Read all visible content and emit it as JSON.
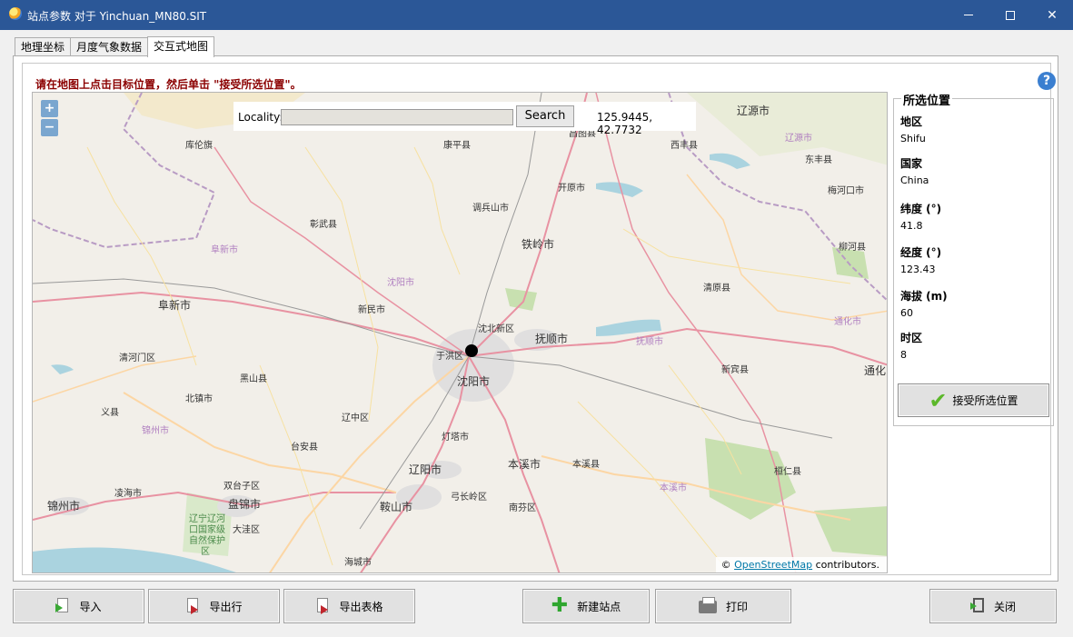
{
  "window": {
    "title": "站点参数 对于 Yinchuan_MN80.SIT",
    "app_icon": "app-globe-icon"
  },
  "tabs": [
    {
      "label": "地理坐标",
      "active": false
    },
    {
      "label": "月度气象数据",
      "active": false
    },
    {
      "label": "交互式地图",
      "active": true
    }
  ],
  "instruction": "请在地图上点击目标位置，然后单击 \"接受所选位置\"。",
  "map": {
    "zoom_in": "+",
    "zoom_out": "−",
    "locality_label": "Locality:",
    "locality_value": "",
    "search_button": "Search",
    "coords": "125.9445, 42.7732",
    "attribution_prefix": "©",
    "attribution_link": "OpenStreetMap",
    "attribution_suffix": "contributors.",
    "places": [
      "辽源市",
      "辽源市",
      "东丰县",
      "梅河口市",
      "柳河县",
      "通化市",
      "通化",
      "康平县",
      "西丰县",
      "昌图县",
      "开原市",
      "调兵山市",
      "铁岭市",
      "彰武县",
      "库伦旗",
      "阜新市",
      "阜新市",
      "沈阳市",
      "新民市",
      "沈北新区",
      "于洪区",
      "抚顺市",
      "抚顺市",
      "沈阳市",
      "清原县",
      "新宾县",
      "清河门区",
      "黑山县",
      "北镇市",
      "锦州市",
      "义县",
      "辽中区",
      "台安县",
      "灯塔市",
      "辽阳市",
      "本溪市",
      "本溪县",
      "桓仁县",
      "双台子区",
      "凌海市",
      "盘锦市",
      "大洼区",
      "鞍山市",
      "弓长岭区",
      "南芬区",
      "本溪市",
      "锦州市",
      "辽宁辽河口国家级自然保护区",
      "海城市"
    ]
  },
  "selected": {
    "legend": "所选位置",
    "fields": [
      {
        "label": "地区",
        "value": "Shifu"
      },
      {
        "label": "国家",
        "value": "China"
      },
      {
        "label": "纬度 (°)",
        "value": "41.8"
      },
      {
        "label": "经度 (°)",
        "value": "123.43"
      },
      {
        "label": "海拔 (m)",
        "value": "60"
      },
      {
        "label": "时区",
        "value": "8"
      }
    ],
    "accept_button": "接受所选位置"
  },
  "buttons": {
    "import": "导入",
    "export_row": "导出行",
    "export_table": "导出表格",
    "new_site": "新建站点",
    "print": "打印",
    "close": "关闭"
  },
  "colors": {
    "titlebar": "#2b5797",
    "instruction": "#8b0000",
    "map_bg": "#f2efe9",
    "link": "#0078a8"
  }
}
